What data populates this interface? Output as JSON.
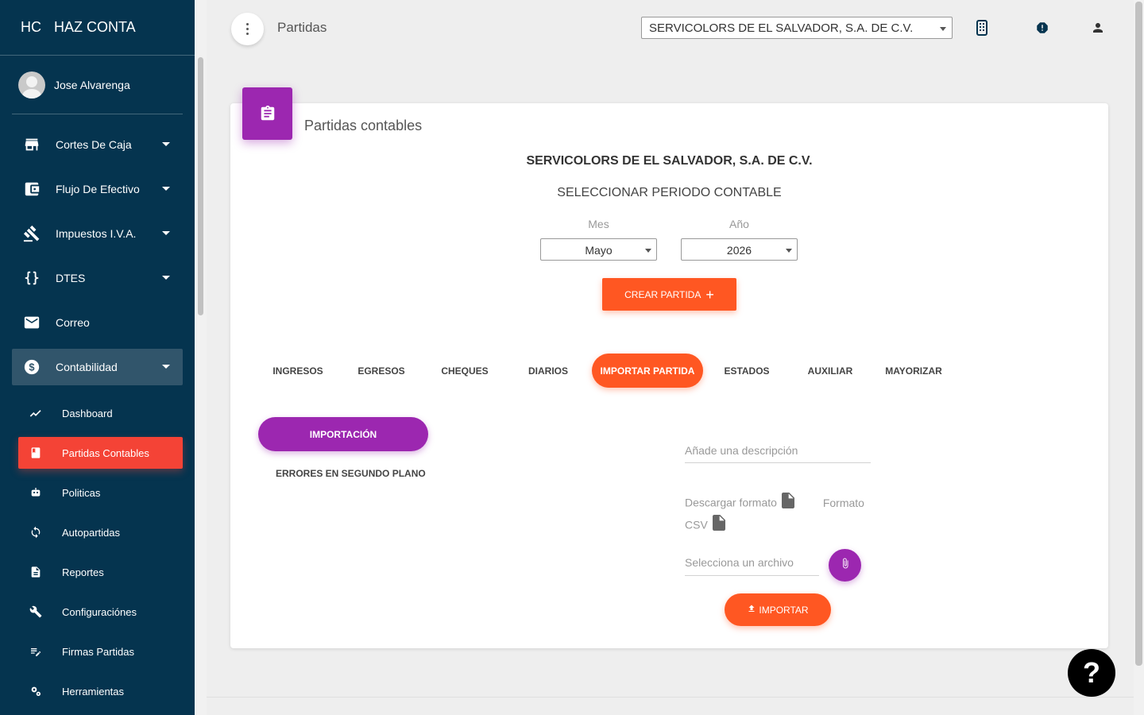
{
  "sidebar": {
    "brand_mini": "HC",
    "brand_name": "HAZ CONTA",
    "user_name": "Jose Alvarenga",
    "items": [
      {
        "label": "Cortes De Caja",
        "icon": "store-icon"
      },
      {
        "label": "Flujo De Efectivo",
        "icon": "wallet-icon"
      },
      {
        "label": "Impuestos I.V.A.",
        "icon": "gavel-icon"
      },
      {
        "label": "DTES",
        "icon": "braces-icon"
      },
      {
        "label": "Correo",
        "icon": "mail-icon"
      },
      {
        "label": "Contabilidad",
        "icon": "dollar-icon"
      }
    ],
    "subitems": [
      {
        "label": "Dashboard",
        "icon": "trending-icon"
      },
      {
        "label": "Partidas Contables",
        "icon": "book-icon"
      },
      {
        "label": "Politicas",
        "icon": "robot-icon"
      },
      {
        "label": "Autopartidas",
        "icon": "sync-icon"
      },
      {
        "label": "Reportes",
        "icon": "document-icon"
      },
      {
        "label": "Configuraciónes",
        "icon": "wrench-icon"
      },
      {
        "label": "Firmas Partidas",
        "icon": "edit-note-icon"
      },
      {
        "label": "Herramientas",
        "icon": "settings-icon"
      }
    ]
  },
  "topbar": {
    "title": "Partidas",
    "company": "SERVICOLORS DE EL SALVADOR, S.A. DE C.V."
  },
  "card": {
    "title": "Partidas contables",
    "company_heading": "SERVICOLORS DE EL SALVADOR, S.A. DE C.V.",
    "period_heading": "SELECCIONAR PERIODO CONTABLE",
    "month_label": "Mes",
    "month_value": "Mayo",
    "year_label": "Año",
    "year_value": "2026",
    "create_button": "CREAR PARTIDA",
    "tabs": [
      "INGRESOS",
      "EGRESOS",
      "CHEQUES",
      "DIARIOS",
      "IMPORTAR PARTIDA",
      "ESTADOS",
      "AUXILIAR",
      "MAYORIZAR"
    ],
    "active_tab": "IMPORTAR PARTIDA",
    "import_tab": "IMPORTACIÓN",
    "errors_link": "ERRORES EN SEGUNDO PLANO",
    "description_placeholder": "Añade una descripción",
    "download_format": "Descargar formato",
    "format_csv_1": "Formato",
    "format_csv_2": "CSV",
    "file_placeholder": "Selecciona un archivo",
    "import_button": "IMPORTAR"
  },
  "help": {
    "label": "?"
  },
  "colors": {
    "sidebar_bg": "#05344f",
    "accent_orange": "#ff5722",
    "accent_purple": "#9c27b0",
    "active_red": "#f44336"
  }
}
